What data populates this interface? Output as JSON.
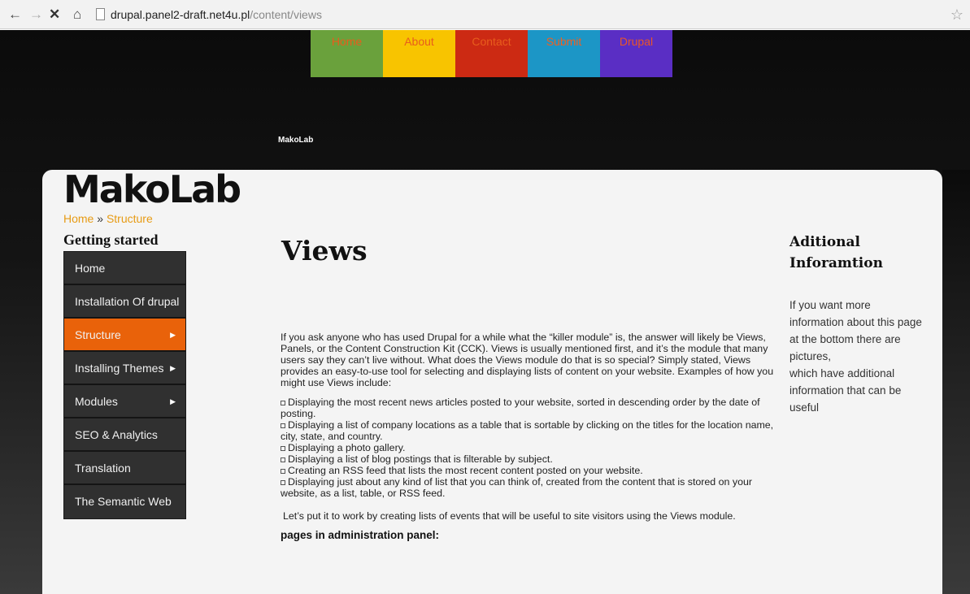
{
  "browser": {
    "url_host": "drupal.panel2-draft.net4u.pl",
    "url_path": "/content/views",
    "back_icon": "back-arrow-icon",
    "forward_icon": "forward-arrow-icon",
    "stop_icon": "stop-icon",
    "home_icon": "home-icon",
    "star_icon": "bookmark-star-icon"
  },
  "topnav": {
    "items": [
      {
        "label": "Home",
        "color": "#6aa13c"
      },
      {
        "label": "About",
        "color": "#f8c400"
      },
      {
        "label": "Contact",
        "color": "#cc2a13"
      },
      {
        "label": "Submit",
        "color": "#1c96c6"
      },
      {
        "label": "Drupal",
        "color": "#5a2ec4"
      }
    ]
  },
  "header": {
    "small_logo": "MakoLab",
    "brand": "MakoLab"
  },
  "breadcrumb": {
    "home": "Home",
    "separator": "»",
    "current": "Structure"
  },
  "sidebar": {
    "title": "Getting started",
    "items": [
      {
        "label": "Home",
        "has_arrow": false,
        "active": false
      },
      {
        "label": "Installation Of drupal",
        "has_arrow": false,
        "active": false
      },
      {
        "label": "Structure",
        "has_arrow": true,
        "active": true
      },
      {
        "label": "Installing Themes",
        "has_arrow": true,
        "active": false
      },
      {
        "label": "Modules",
        "has_arrow": true,
        "active": false
      },
      {
        "label": "SEO & Analytics",
        "has_arrow": false,
        "active": false
      },
      {
        "label": "Translation",
        "has_arrow": false,
        "active": false
      },
      {
        "label": "The Semantic Web",
        "has_arrow": false,
        "active": false
      }
    ],
    "arrow_glyph": "▶",
    "accent_color": "#e9620a"
  },
  "main": {
    "title": "Views",
    "intro": "If you ask anyone who has used Drupal for a while what the “killer module” is, the answer will likely be Views, Panels, or the Content Construction Kit (CCK). Views is usually mentioned first, and it’s the module that many users say they can’t live without. What does the Views module do that is so special? Simply stated, Views provides an easy-to-use tool for selecting and displaying lists of content on your website. Examples of how you might use Views include:",
    "bullets": [
      "Displaying the most recent news articles posted to your website, sorted in descending order by the date of posting.",
      "Displaying a list of company locations as a table that is sortable by clicking on the titles for the location name, city, state, and country.",
      "Displaying a photo gallery.",
      "Displaying a list of blog postings that is filterable by subject.",
      "Creating an RSS feed that lists the most recent content posted on your website.",
      "Displaying just about any kind of list that you can think of, created from the content that is stored on your website, as a list, table, or RSS feed."
    ],
    "closing": "Let’s put it to work by creating lists of events that will be useful to site visitors using the Views module.",
    "subhead": "pages in administration panel:"
  },
  "aside": {
    "title_line1": "Aditional",
    "title_line2": "Inforamtion",
    "text": "If you want more information about this page at the bottom there are pictures,",
    "text2": "which have additional information that can be useful"
  }
}
